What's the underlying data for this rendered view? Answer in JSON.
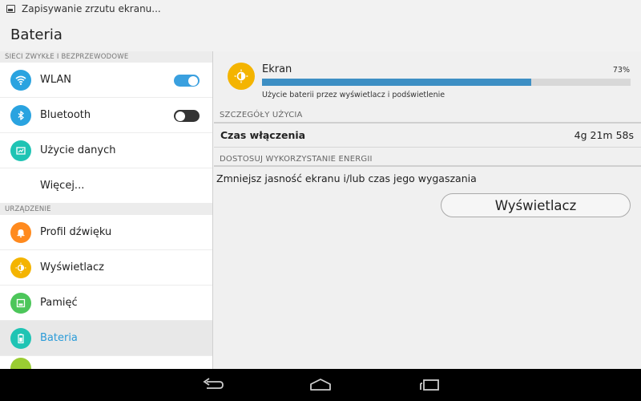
{
  "status_bar": {
    "notification": "Zapisywanie zrzutu ekranu..."
  },
  "action_bar": {
    "title": "Bateria"
  },
  "sidebar": {
    "sections": [
      {
        "header": "SIECI ZWYKŁE I BEZPRZEWODOWE"
      },
      {
        "header": "URZĄDZENIE"
      }
    ],
    "items": [
      {
        "label": "WLAN",
        "icon": "wifi-icon",
        "color": "#2aa3e0",
        "toggle": "on"
      },
      {
        "label": "Bluetooth",
        "icon": "bluetooth-icon",
        "color": "#2aa3e0",
        "toggle": "off"
      },
      {
        "label": "Użycie danych",
        "icon": "data-usage-icon",
        "color": "#1fc4b4"
      },
      {
        "label": "Więcej..."
      },
      {
        "label": "Profil dźwięku",
        "icon": "bell-icon",
        "color": "#ff8a1e"
      },
      {
        "label": "Wyświetlacz",
        "icon": "brightness-icon",
        "color": "#f4b400"
      },
      {
        "label": "Pamięć",
        "icon": "storage-icon",
        "color": "#4cc65a"
      },
      {
        "label": "Bateria",
        "icon": "battery-icon",
        "color": "#1fc4b4",
        "selected": true
      }
    ]
  },
  "detail": {
    "usage": {
      "name": "Ekran",
      "percent_label": "73%",
      "percent": 73,
      "description": "Użycie baterii przez wyświetlacz i podświetlenie",
      "bar_color": "#3d8fc4",
      "icon": "brightness-icon"
    },
    "usage_details_header": "SZCZEGÓŁY UŻYCIA",
    "time_on": {
      "label": "Czas włączenia",
      "value": "4g 21m 58s"
    },
    "adjust_header": "DOSTOSUJ WYKORZYSTANIE ENERGII",
    "tip": "Zmniejsz jasność ekranu i/lub czas jego wygaszania",
    "button_label": "Wyświetlacz"
  },
  "nav_bar": {
    "buttons": [
      "back-icon",
      "home-icon",
      "recent-apps-icon"
    ]
  }
}
